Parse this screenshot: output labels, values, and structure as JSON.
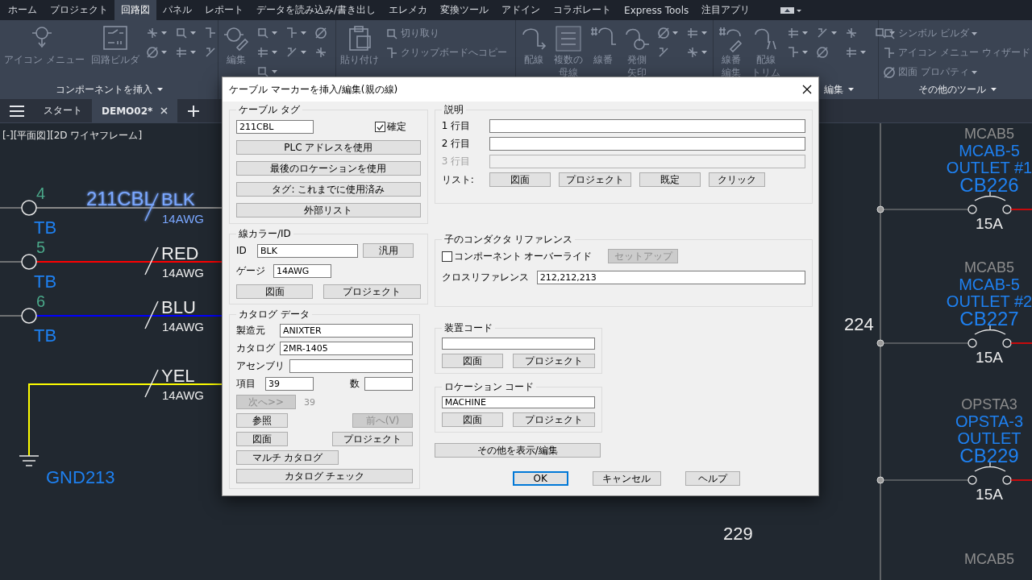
{
  "menu_tabs": [
    {
      "label": "ホーム",
      "selected": false
    },
    {
      "label": "プロジェクト",
      "selected": false
    },
    {
      "label": "回路図",
      "selected": true
    },
    {
      "label": "パネル",
      "selected": false
    },
    {
      "label": "レポート",
      "selected": false
    },
    {
      "label": "データを読み込み/書き出し",
      "selected": false
    },
    {
      "label": "エレメカ",
      "selected": false
    },
    {
      "label": "変換ツール",
      "selected": false
    },
    {
      "label": "アドイン",
      "selected": false
    },
    {
      "label": "コラボレート",
      "selected": false
    },
    {
      "label": "Express Tools",
      "selected": false
    },
    {
      "label": "注目アプリ",
      "selected": false
    }
  ],
  "ribbon_panels": [
    {
      "title": "コンポーネントを挿入",
      "large_tools": [
        {
          "lines": [
            "アイコン メニュー"
          ]
        },
        {
          "lines": [
            "回路ビルダ"
          ]
        }
      ]
    },
    {
      "large_tools": [
        {
          "lines": [
            "編集"
          ]
        }
      ]
    },
    {
      "large_tools": [
        {
          "lines": [
            "貼り付け"
          ]
        }
      ],
      "small_tools": [
        {
          "label": "切り取り",
          "dropdown": false
        },
        {
          "label": "クリップボードへコピー",
          "dropdown": false
        }
      ]
    },
    {
      "large_tools": [
        {
          "lines": [
            "配線"
          ]
        },
        {
          "lines": [
            "複数の",
            "母線"
          ]
        },
        {
          "lines": [
            "線番"
          ]
        },
        {
          "lines": [
            "発側",
            "矢印"
          ]
        }
      ]
    },
    {
      "title": "編集",
      "large_tools": [
        {
          "lines": [
            "線番",
            "編集"
          ]
        },
        {
          "lines": [
            "配線",
            "トリム"
          ]
        }
      ]
    },
    {
      "title": "その他のツール",
      "small_tools": [
        {
          "label": "シンボル ビルダ",
          "dropdown": true
        },
        {
          "label": "アイコン メニュー ウィザード",
          "dropdown": false
        },
        {
          "label": "図面 プロパティ",
          "dropdown": true
        }
      ]
    }
  ],
  "doc_tabs": [
    {
      "label": "スタート",
      "selected": false,
      "closable": false
    },
    {
      "label": "DEMO02*",
      "selected": true,
      "closable": true
    }
  ],
  "viewport_label": "[-][平面図][2D ワイヤフレーム]",
  "canvas": {
    "wires": [
      {
        "kind": "terminal",
        "number": "4",
        "tag": "TB",
        "color": "#8a8a8a",
        "cable": "211CBL",
        "marker": "BLK",
        "gauge": "14AWG",
        "highlighted": true
      },
      {
        "kind": "terminal",
        "number": "5",
        "tag": "TB",
        "color": "#ff0000",
        "marker": "RED",
        "gauge": "14AWG",
        "highlighted": false
      },
      {
        "kind": "terminal",
        "number": "6",
        "tag": "TB",
        "color": "#0000ff",
        "marker": "BLU",
        "gauge": "14AWG",
        "highlighted": false
      },
      {
        "kind": "ground",
        "tag": "GND213",
        "color": "#ffff00",
        "marker": "YEL",
        "gauge": "14AWG",
        "highlighted": false
      }
    ],
    "breakers": [
      {
        "ref": "MCAB5",
        "location": "MCAB-5",
        "description": "OUTLET #1",
        "tag": "CB226",
        "rating": "15A"
      },
      {
        "ref": "MCAB5",
        "location": "MCAB-5",
        "description": "OUTLET #2",
        "tag": "CB227",
        "rating": "15A"
      },
      {
        "ref": "OPSTA3",
        "location": "OPSTA-3",
        "description": "OUTLET",
        "tag": "CB229",
        "rating": "15A"
      },
      {
        "ref": "MCAB5"
      }
    ],
    "line_numbers": [
      "224",
      "229"
    ]
  },
  "dialog": {
    "title": "ケーブル マーカーを挿入/編集(親の線)",
    "cable_tag": {
      "title": "ケーブル タグ",
      "value": "211CBL",
      "confirm": {
        "label": "確定",
        "checked": true
      },
      "buttons": [
        "PLC アドレスを使用",
        "最後のロケーションを使用",
        "タグ: これまでに使用済み",
        "外部リスト"
      ]
    },
    "wire_color": {
      "title": "線カラー/ID",
      "id_label": "ID",
      "id_value": "BLK",
      "generic_button": "汎用",
      "gauge_label": "ゲージ",
      "gauge_value": "14AWG",
      "buttons": [
        "図面",
        "プロジェクト"
      ]
    },
    "catalog": {
      "title": "カタログ データ",
      "manufacturer": {
        "label": "製造元",
        "value": "ANIXTER"
      },
      "catalog": {
        "label": "カタログ",
        "value": "2MR-1405"
      },
      "assembly": {
        "label": "アセンブリ"
      },
      "item": {
        "label": "項目",
        "value": "39"
      },
      "count": {
        "label": "数"
      },
      "next": {
        "label": "次へ>>",
        "disabled": true
      },
      "next_value": "39",
      "lookup": {
        "label": "参照",
        "disabled": false
      },
      "previous": {
        "label": "前へ(V)",
        "disabled": true
      },
      "buttons": [
        "図面",
        "プロジェクト"
      ],
      "multi": "マルチ カタログ",
      "check": "カタログ チェック"
    },
    "description": {
      "title": "説明",
      "lines": [
        {
          "label": "1 行目",
          "disabled": false
        },
        {
          "label": "2 行目",
          "disabled": false
        },
        {
          "label": "3 行目",
          "disabled": true
        }
      ],
      "list_label": "リスト:",
      "list_buttons": [
        "図面",
        "プロジェクト",
        "既定",
        "クリック"
      ]
    },
    "child_reference": {
      "title": "子のコンダクタ リファレンス",
      "override": {
        "label": "コンポーネント オーバーライド",
        "checked": false
      },
      "setup": {
        "label": "セットアップ",
        "disabled": true
      },
      "xref_label": "クロスリファレンス",
      "xref_value": "212,212,213"
    },
    "device_code": {
      "title": "装置コード",
      "buttons": [
        "図面",
        "プロジェクト"
      ]
    },
    "location_code": {
      "title": "ロケーション コード",
      "value": "MACHINE",
      "buttons": [
        "図面",
        "プロジェクト"
      ]
    },
    "show_edit": "その他を表示/編集",
    "footer": [
      {
        "label": "OK",
        "default": true
      },
      {
        "label": "キャンセル",
        "default": false
      },
      {
        "label": "ヘルプ",
        "default": false
      }
    ]
  }
}
